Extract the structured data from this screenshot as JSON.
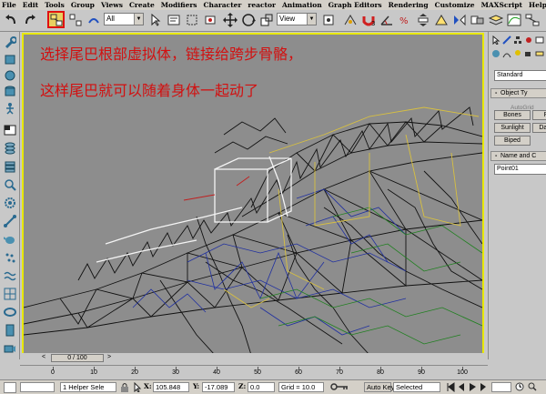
{
  "menu": [
    "File",
    "Edit",
    "Tools",
    "Group",
    "Views",
    "Create",
    "Modifiers",
    "Character",
    "reactor",
    "Animation",
    "Graph Editors",
    "Rendering",
    "Customize",
    "MAXScript",
    "Help"
  ],
  "toolbar": {
    "selection_filter": "All",
    "reference_coord": "View",
    "highlighted_tool": "select-and-link"
  },
  "caption": {
    "line1": "选择尾巴根部虚拟体，链接给跨步骨骼，",
    "line2": "这样尾巴就可以随着身体一起动了"
  },
  "command_panel": {
    "category": "Standard",
    "object_type_title": "Object Ty",
    "autogrid": "AutoGrid",
    "buttons": [
      "Bones",
      "Ring",
      "Sunlight",
      "Daylight",
      "Biped"
    ],
    "name_color_title": "Name and C",
    "name_value": "Point01"
  },
  "timeline": {
    "slider_label": "0 / 100",
    "ruler_ticks": [
      "0",
      "10",
      "20",
      "30",
      "40",
      "50",
      "60",
      "70",
      "80",
      "90",
      "100"
    ]
  },
  "status": {
    "selection": "1 Helper Sele",
    "x_label": "X:",
    "x_value": "105.848",
    "y_label": "Y:",
    "y_value": "-17.089",
    "z_label": "Z:",
    "z_value": "0.0",
    "grid": "Grid = 10.0",
    "autokey": "Auto Key",
    "autokey_mode": "Selected"
  },
  "colors": {
    "accent_highlight": "#e8e800",
    "caption_red": "#d21010",
    "viewport_bg": "#8d8d8d"
  }
}
